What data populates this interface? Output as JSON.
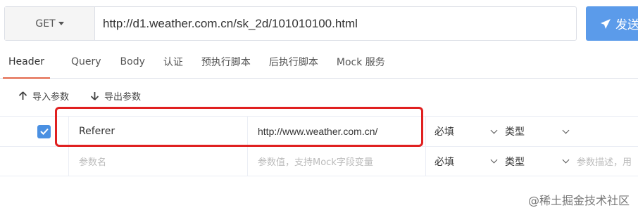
{
  "request": {
    "method": "GET",
    "url": "http://d1.weather.com.cn/sk_2d/101010100.html",
    "send_label": "发送"
  },
  "tabs": [
    {
      "label": "Header"
    },
    {
      "label": "Query"
    },
    {
      "label": "Body"
    },
    {
      "label": "认证"
    },
    {
      "label": "预执行脚本"
    },
    {
      "label": "后执行脚本"
    },
    {
      "label": "Mock 服务"
    }
  ],
  "actions": {
    "import_label": "导入参数",
    "export_label": "导出参数"
  },
  "params": [
    {
      "checked": true,
      "name": "Referer",
      "value": "http://www.weather.com.cn/",
      "required": "必填",
      "type": "类型"
    }
  ],
  "new_row": {
    "name_placeholder": "参数名",
    "value_placeholder": "参数值，支持Mock字段变量",
    "required": "必填",
    "type": "类型",
    "desc_placeholder": "参数描述，用"
  },
  "watermark": "@稀土掘金技术社区",
  "colors": {
    "accent_tab": "#e2674a",
    "send_button": "#5b9bea",
    "checkbox": "#4a90e2",
    "highlight": "#e02020"
  },
  "icons": [
    "caret-down-icon",
    "paper-plane-icon",
    "arrow-up-icon",
    "arrow-down-icon",
    "check-icon",
    "chevron-down-icon"
  ]
}
